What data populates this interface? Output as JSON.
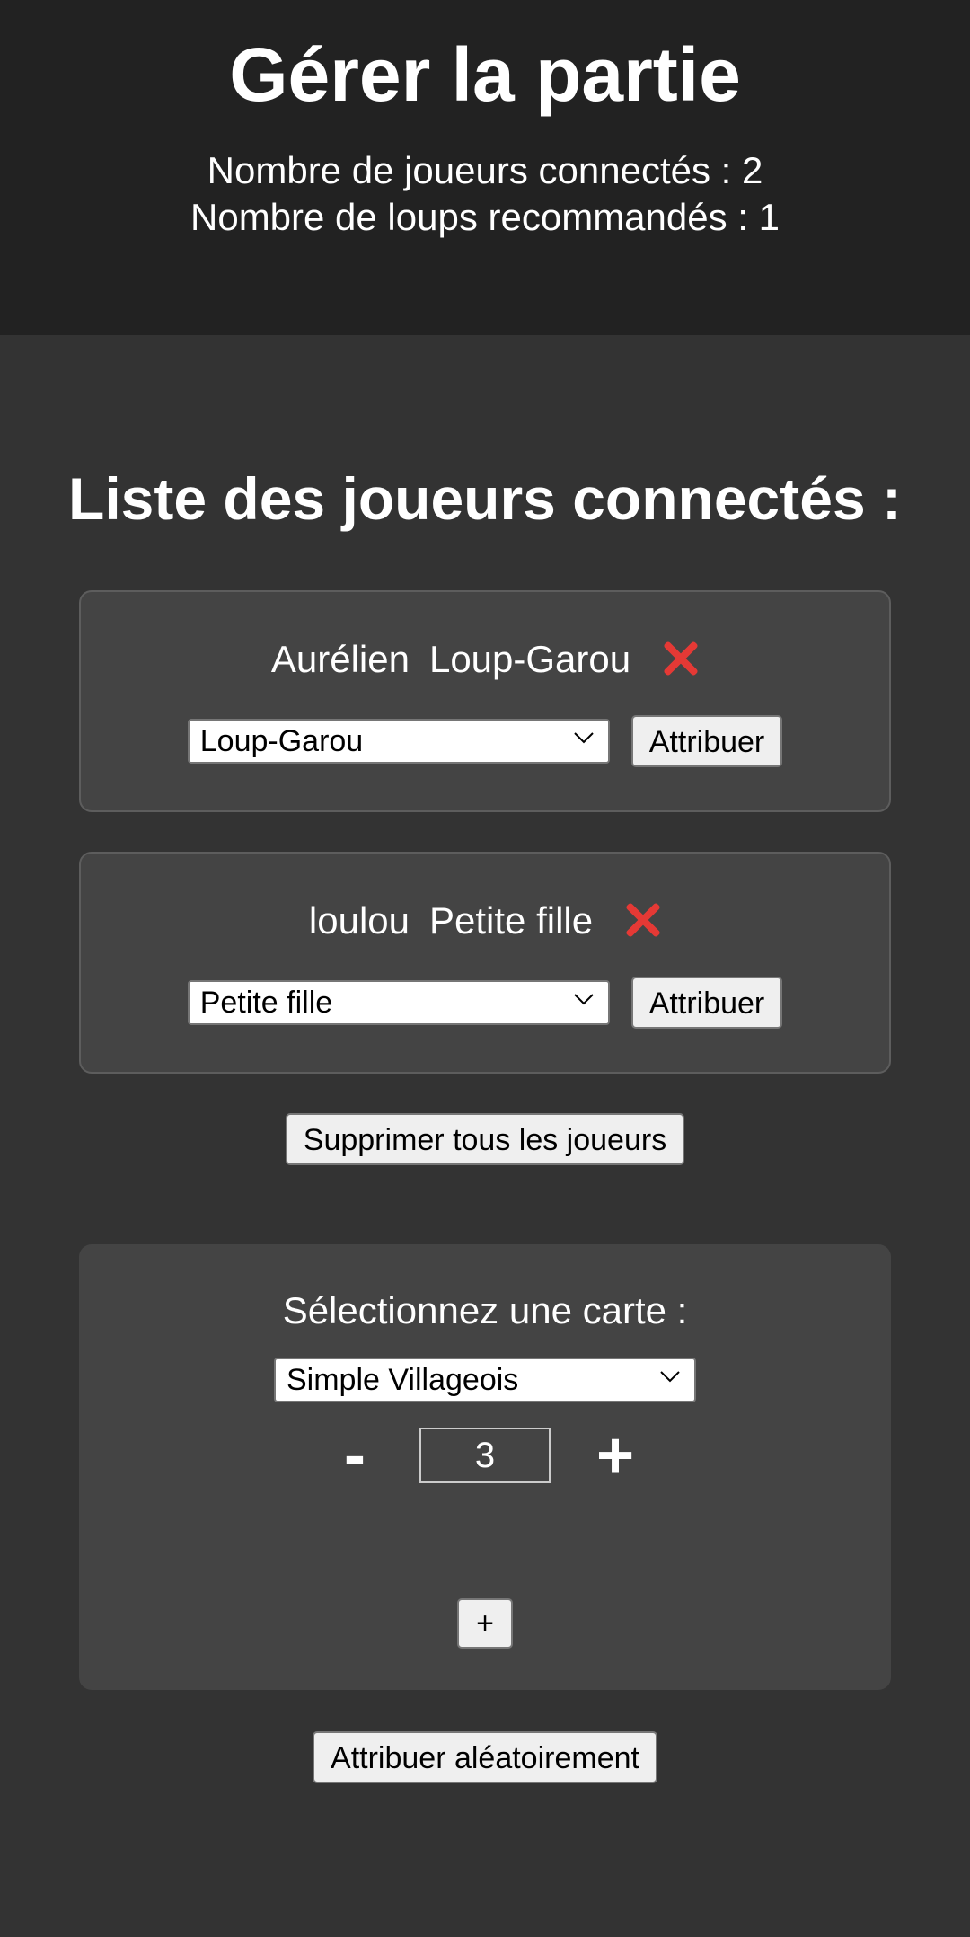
{
  "header": {
    "title": "Gérer la partie",
    "players_connected": "Nombre de joueurs connectés : 2",
    "wolves_recommended": "Nombre de loups recommandés : 1"
  },
  "players_section": {
    "title": "Liste des joueurs connectés :",
    "players": [
      {
        "name": "Aurélien",
        "role": "Loup-Garou",
        "selected_role": "Loup-Garou",
        "assign_label": "Attribuer"
      },
      {
        "name": "loulou",
        "role": "Petite fille",
        "selected_role": "Petite fille",
        "assign_label": "Attribuer"
      }
    ],
    "delete_all_label": "Supprimer tous les joueurs"
  },
  "card_selector": {
    "label": "Sélectionnez une carte :",
    "selected_card": "Simple Villageois",
    "minus_label": "-",
    "count": "3",
    "plus_label": "+",
    "add_label": "+"
  },
  "random_assign_label": "Attribuer aléatoirement",
  "icons": {
    "remove": "close-icon",
    "dropdown": "chevron-down-icon"
  },
  "colors": {
    "header_bg": "#222222",
    "page_bg": "#333333",
    "card_bg": "#444444",
    "remove_icon": "#e53935"
  }
}
